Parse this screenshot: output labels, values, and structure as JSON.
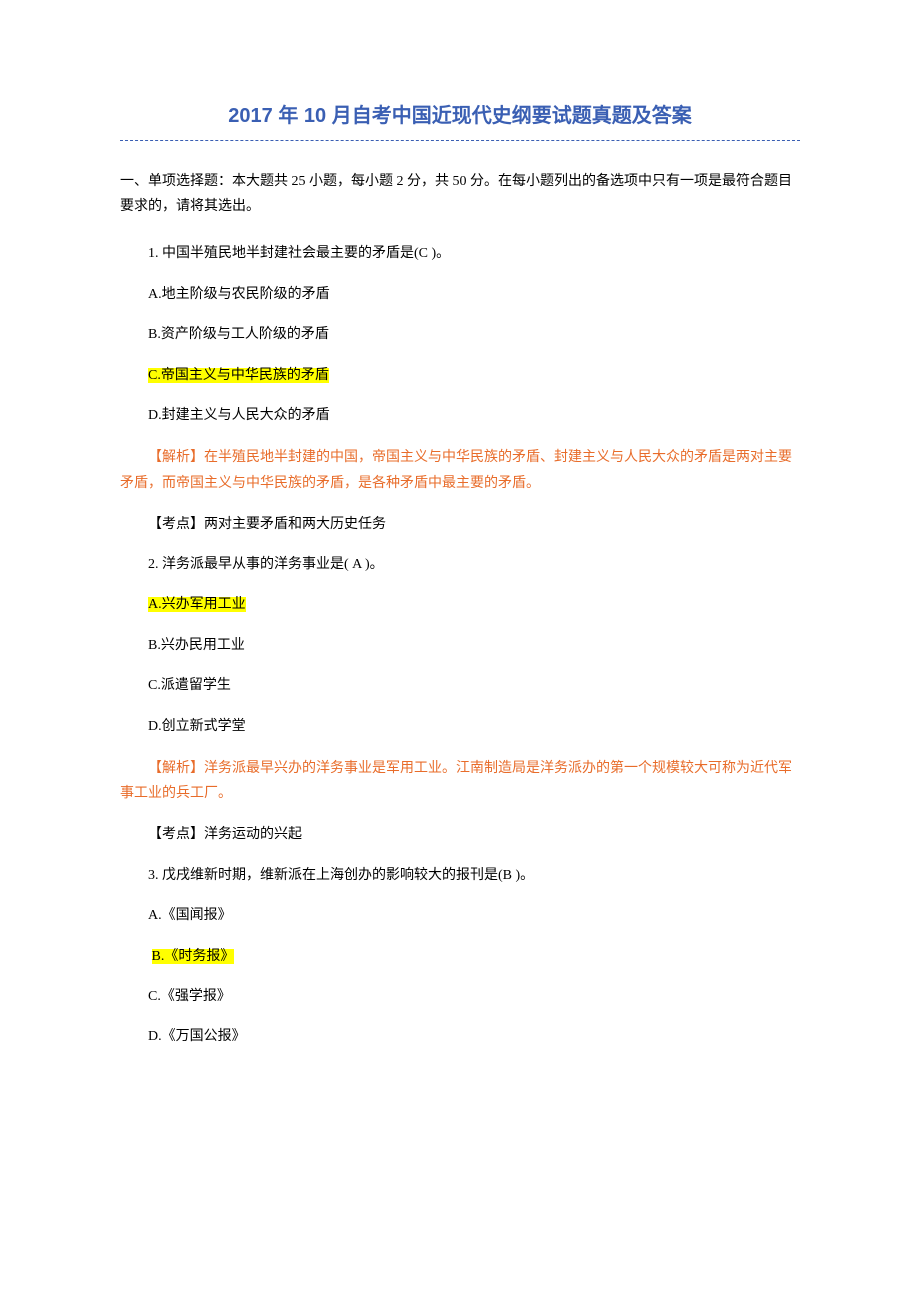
{
  "title": "2017 年 10 月自考中国近现代史纲要试题真题及答案",
  "instructions": "一、单项选择题：本大题共 25 小题，每小题 2 分，共 50 分。在每小题列出的备选项中只有一项是最符合题目要求的，请将其选出。",
  "questions": [
    {
      "number": "1.",
      "text": "中国半殖民地半封建社会最主要的矛盾是(C  )。",
      "options": {
        "A": "A.地主阶级与农民阶级的矛盾",
        "B": "B.资产阶级与工人阶级的矛盾",
        "C": "C.帝国主义与中华民族的矛盾",
        "D": "D.封建主义与人民大众的矛盾"
      },
      "correct": "C",
      "analysis": "【解析】在半殖民地半封建的中国，帝国主义与中华民族的矛盾、封建主义与人民大众的矛盾是两对主要矛盾，而帝国主义与中华民族的矛盾，是各种矛盾中最主要的矛盾。",
      "keypoint": "【考点】两对主要矛盾和两大历史任务"
    },
    {
      "number": "2.",
      "text": "洋务派最早从事的洋务事业是(   A  )。",
      "options": {
        "A": "A.兴办军用工业",
        "B": "B.兴办民用工业",
        "C": "C.派遣留学生",
        "D": "D.创立新式学堂"
      },
      "correct": "A",
      "analysis": "【解析】洋务派最早兴办的洋务事业是军用工业。江南制造局是洋务派办的第一个规模较大可称为近代军事工业的兵工厂。",
      "keypoint": "【考点】洋务运动的兴起"
    },
    {
      "number": "3.",
      "text": "戊戌维新时期，维新派在上海创办的影响较大的报刊是(B  )。",
      "options": {
        "A": "A.《国闻报》",
        "B": "B.《时务报》",
        "C": "C.《强学报》",
        "D": "D.《万国公报》"
      },
      "correct": "B",
      "analysis": "",
      "keypoint": ""
    }
  ]
}
